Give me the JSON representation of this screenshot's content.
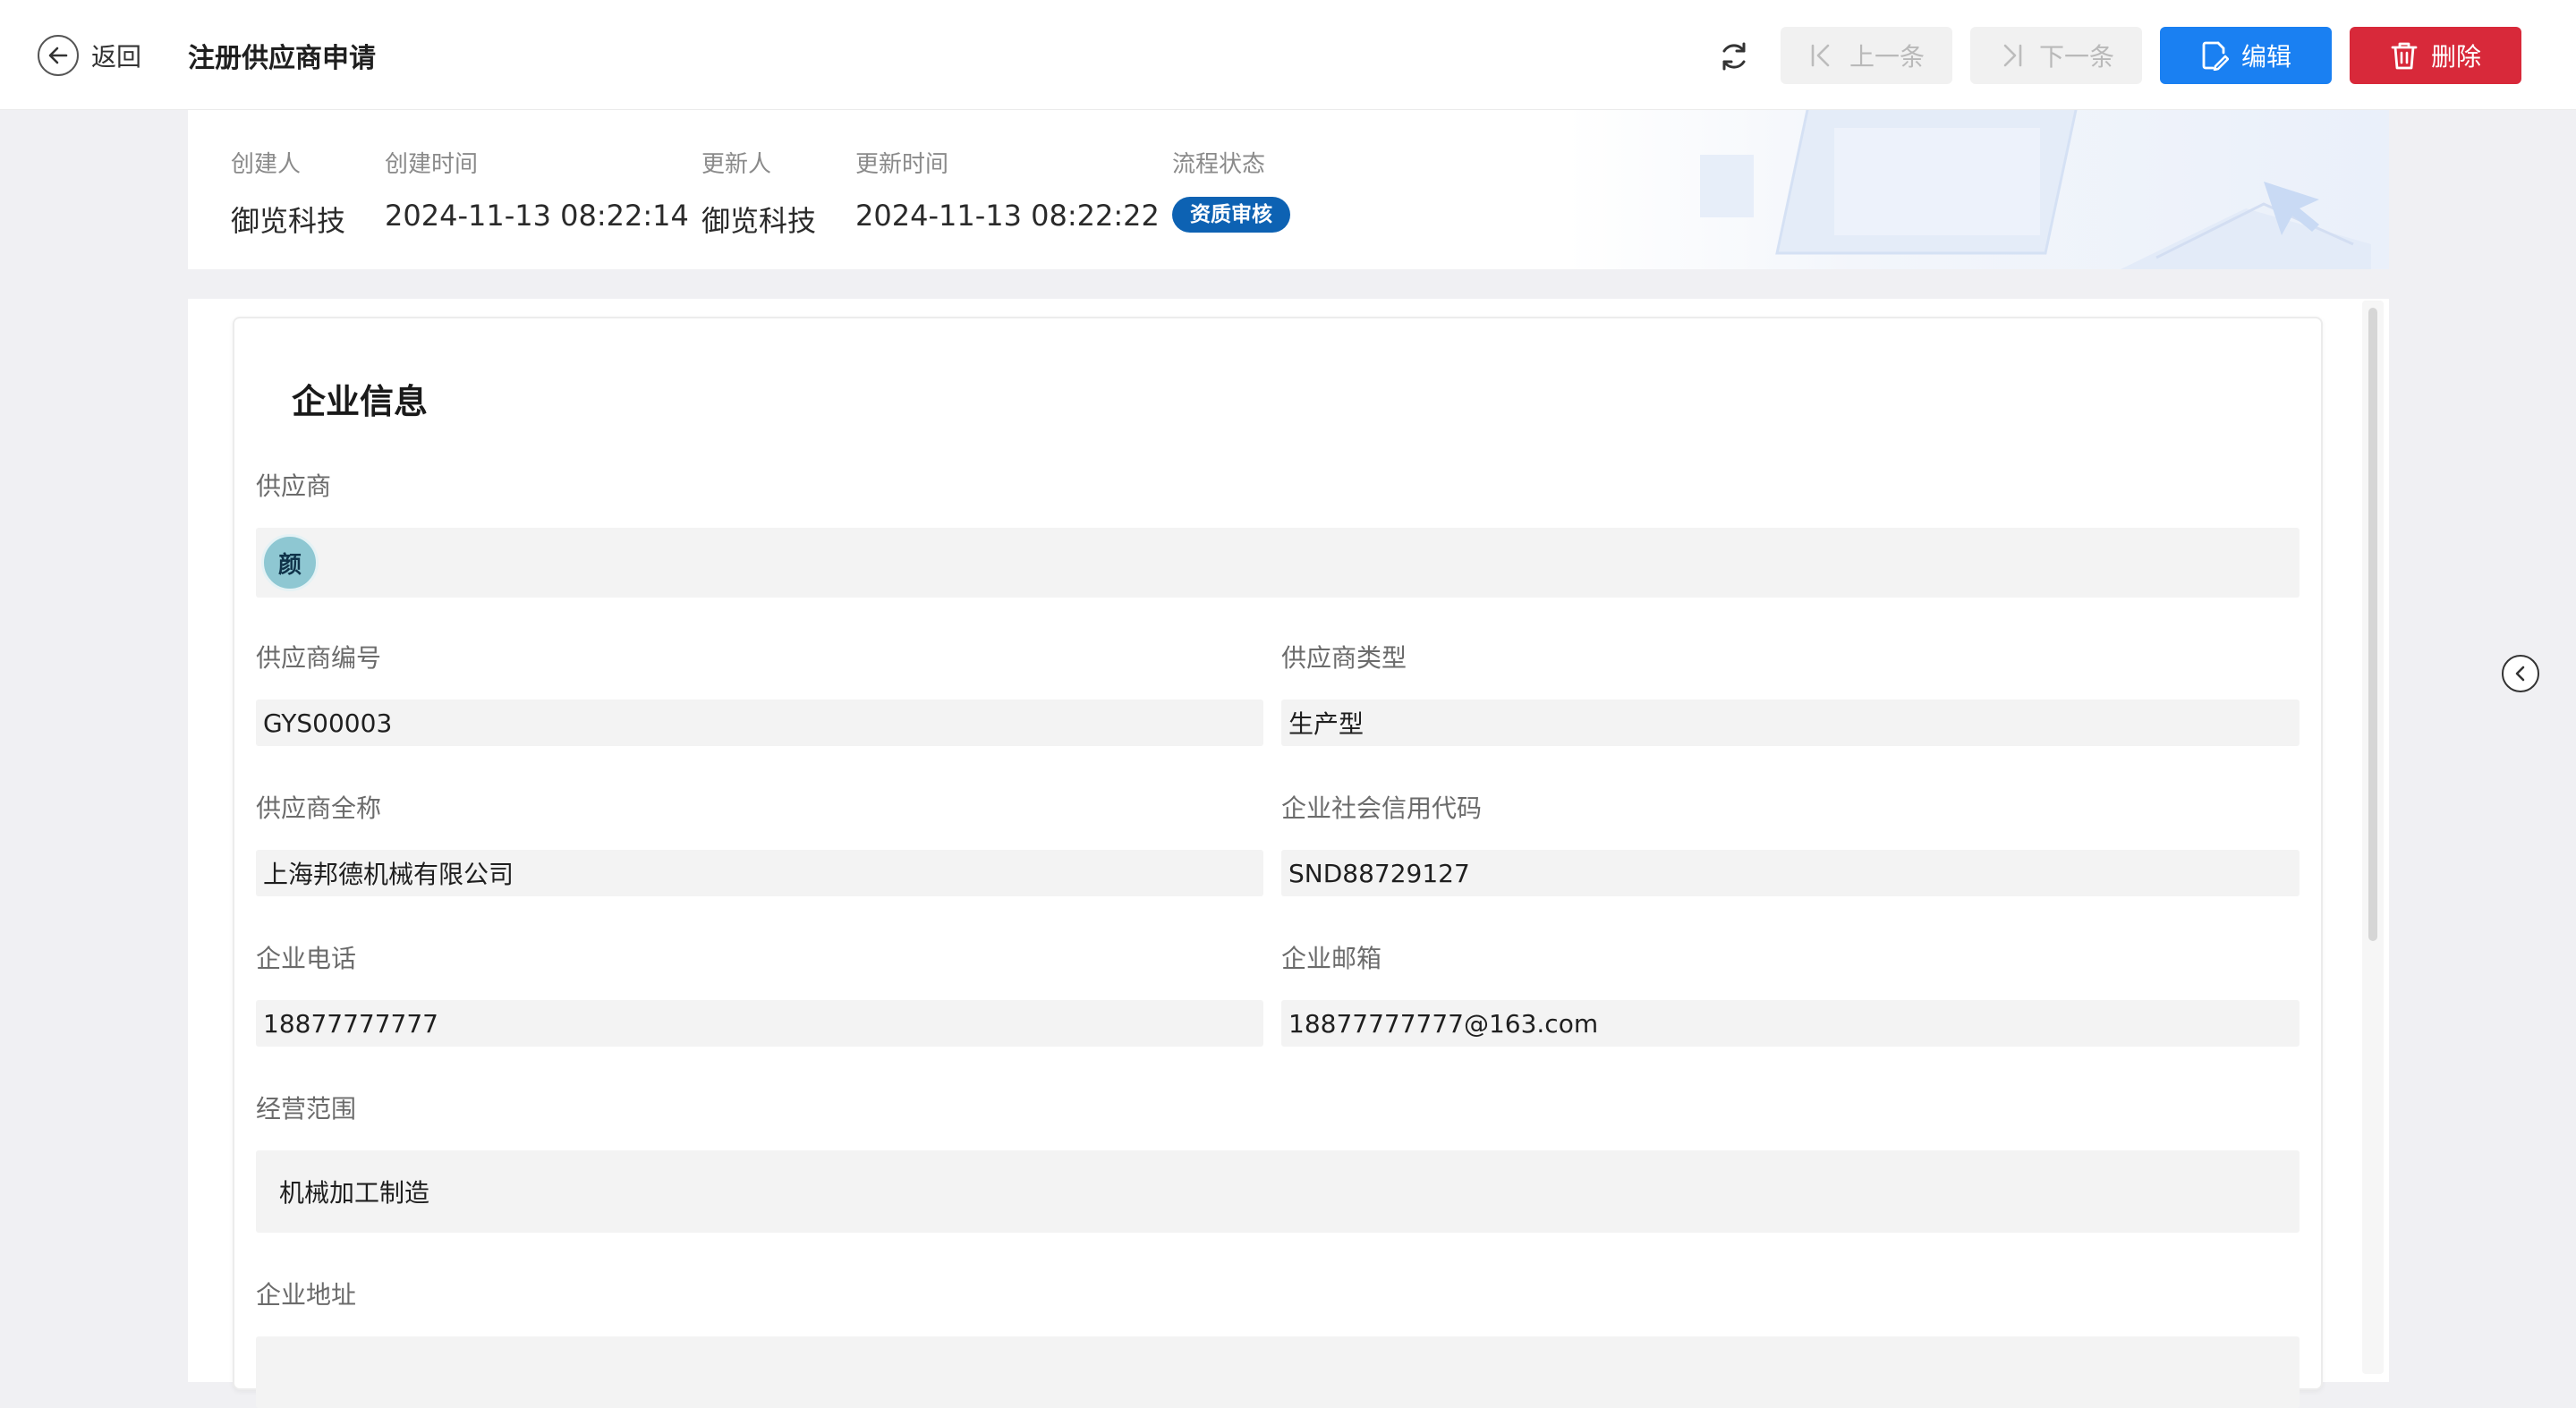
{
  "header": {
    "back_label": "返回",
    "title": "注册供应商申请",
    "prev_label": "上一条",
    "next_label": "下一条",
    "edit_label": "编辑",
    "delete_label": "删除"
  },
  "meta": {
    "creator_label": "创建人",
    "creator_value": "御览科技",
    "created_time_label": "创建时间",
    "created_time_value": "2024-11-13 08:22:14",
    "updater_label": "更新人",
    "updater_value": "御览科技",
    "updated_time_label": "更新时间",
    "updated_time_value": "2024-11-13 08:22:22",
    "status_label": "流程状态",
    "status_value": "资质审核"
  },
  "form": {
    "section_title": "企业信息",
    "supplier_label": "供应商",
    "supplier_avatar": "颜",
    "supplier_code_label": "供应商编号",
    "supplier_code_value": "GYS00003",
    "supplier_type_label": "供应商类型",
    "supplier_type_value": "生产型",
    "full_name_label": "供应商全称",
    "full_name_value": "上海邦德机械有限公司",
    "credit_code_label": "企业社会信用代码",
    "credit_code_value": "SND88729127",
    "phone_label": "企业电话",
    "phone_value": "18877777777",
    "email_label": "企业邮箱",
    "email_value": "18877777777@163.com",
    "scope_label": "经营范围",
    "scope_value": "机械加工制造",
    "address_label": "企业地址",
    "address_value": ""
  },
  "colors": {
    "primary": "#1a80f2",
    "danger": "#d8293a",
    "status_badge": "#0d62b3",
    "field_bg": "#f3f3f3"
  },
  "icons": [
    "back-arrow-icon",
    "refresh-icon",
    "first-icon",
    "last-icon",
    "edit-icon",
    "trash-icon",
    "chevron-left-icon"
  ]
}
